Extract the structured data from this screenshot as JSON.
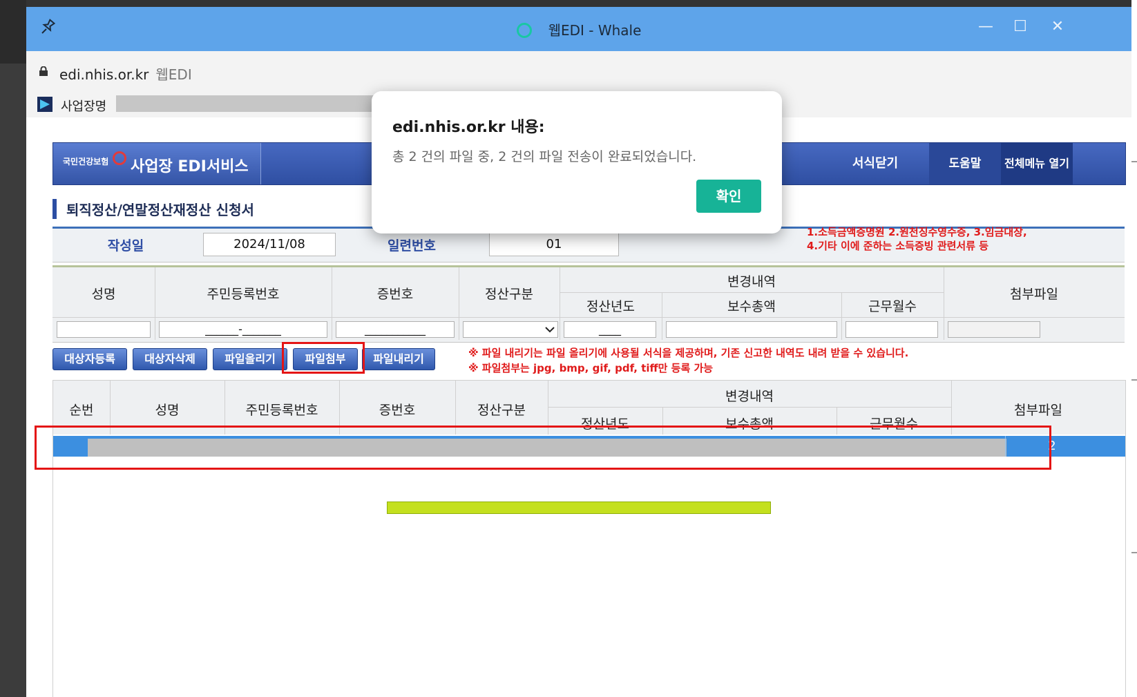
{
  "window": {
    "title": "웹EDI - Whale",
    "minimize_glyph": "—",
    "maximize_glyph": "☐",
    "close_glyph": "✕"
  },
  "address": {
    "url": "edi.nhis.or.kr",
    "site_name": "웹EDI"
  },
  "bizbar": {
    "label": "사업장명"
  },
  "header": {
    "logo_small": "국민건강보험",
    "logo_title": "사업장 EDI서비스",
    "close_form": "서식닫기",
    "help": "도움말",
    "full_menu": "전체메뉴 열기"
  },
  "section_title": "퇴직정산/연말정산재정산 신청서",
  "form": {
    "date_label": "작성일",
    "date_value": "2024/11/08",
    "serial_label": "일련번호",
    "serial_value": "01",
    "note_line1": "1.소득금액증명원 2.원천징수영수증, 3.임금대장,",
    "note_line2": "4.기타 이에 준하는 소득증빙 관련서류 등"
  },
  "input_table": {
    "headers": {
      "name": "성명",
      "rrn": "주민등록번호",
      "cert_no": "증번호",
      "settle_type": "정산구분",
      "change": "변경내역",
      "attach": "첨부파일",
      "settle_year": "정산년도",
      "total_pay": "보수총액",
      "months": "근무월수"
    },
    "values": {
      "name": "",
      "rrn": "______-_______",
      "cert_no": "___________",
      "settle_type": "",
      "settle_year": "____",
      "total_pay": "",
      "months": "",
      "attach": ""
    }
  },
  "actions": {
    "register": "대상자등록",
    "delete": "대상자삭제",
    "upload": "파일올리기",
    "attach": "파일첨부",
    "download": "파일내리기",
    "note1": "※ 파일 내리기는 파일 올리기에 사용될 서식을 제공하며, 기존 신고한 내역도 내려 받을 수 있습니다.",
    "note2": "※ 파일첨부는 jpg, bmp, gif, pdf, tiff만 등록 가능"
  },
  "list_table": {
    "headers": {
      "seq": "순번",
      "name": "성명",
      "rrn": "주민등록번호",
      "cert_no": "증번호",
      "settle_type": "정산구분",
      "change": "변경내역",
      "attach": "첨부파일",
      "settle_year": "정산년도",
      "total_pay": "보수총액",
      "months": "근무월수"
    },
    "rows": [
      {
        "attach_count": "2"
      }
    ]
  },
  "dialog": {
    "title": "edi.nhis.or.kr 내용:",
    "message": "총 2 건의 파일 중, 2 건의 파일 전송이 완료되었습니다.",
    "ok": "확인"
  },
  "colors": {
    "titlebar": "#5ea4ea",
    "header_blue": "#2f4fa2",
    "selected_row": "#3c8fe0",
    "highlight_red": "#e41515",
    "dialog_ok": "#17b397",
    "progress": "#c4e01e"
  }
}
